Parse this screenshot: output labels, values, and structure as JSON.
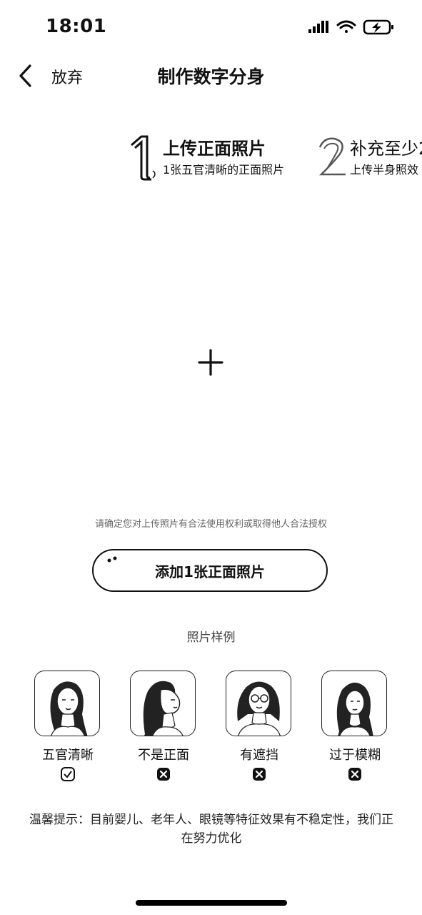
{
  "status_bar": {
    "time": "18:01"
  },
  "nav": {
    "back_label": "放弃",
    "title": "制作数字分身"
  },
  "steps": [
    {
      "number": "1",
      "title": "上传正面照片",
      "subtitle": "1张五官清晰的正面照片"
    },
    {
      "number": "2",
      "title": "补充至少2",
      "subtitle": "上传半身照效"
    }
  ],
  "upload": {
    "legal_note": "请确定您对上传照片有合法使用权利或取得他人合法授权"
  },
  "add_button": {
    "label": "添加1张正面照片"
  },
  "examples": {
    "heading": "照片样例",
    "items": [
      {
        "label": "五官清晰",
        "status": "check-icon"
      },
      {
        "label": "不是正面",
        "status": "cross-icon"
      },
      {
        "label": "有遮挡",
        "status": "cross-icon"
      },
      {
        "label": "过于模糊",
        "status": "cross-icon"
      }
    ]
  },
  "tip": {
    "text": "温馨提示：目前婴儿、老年人、眼镜等特征效果有不稳定性，我们正在努力优化"
  }
}
